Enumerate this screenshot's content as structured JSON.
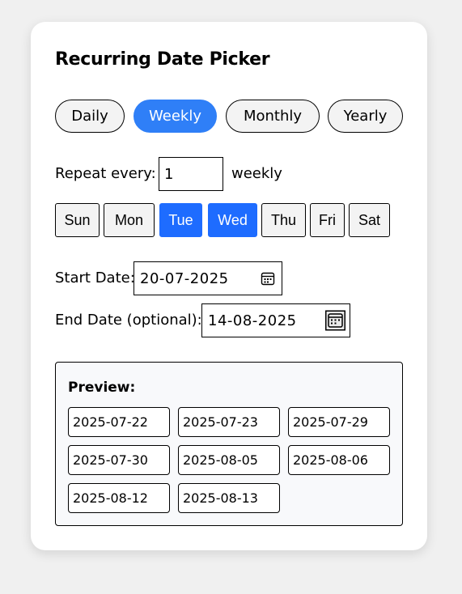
{
  "title": "Recurring Date Picker",
  "frequency_options": [
    {
      "label": "Daily",
      "active": false
    },
    {
      "label": "Weekly",
      "active": true
    },
    {
      "label": "Monthly",
      "active": false
    },
    {
      "label": "Yearly",
      "active": false
    }
  ],
  "repeat": {
    "label": "Repeat every:",
    "value": "1",
    "unit": "weekly"
  },
  "days": [
    {
      "label": "Sun",
      "active": false
    },
    {
      "label": "Mon",
      "active": false
    },
    {
      "label": "Tue",
      "active": true
    },
    {
      "label": "Wed",
      "active": true
    },
    {
      "label": "Thu",
      "active": false
    },
    {
      "label": "Fri",
      "active": false
    },
    {
      "label": "Sat",
      "active": false
    }
  ],
  "start_date": {
    "label": "Start Date:",
    "value": "20-07-2025",
    "icon": "calendar-icon"
  },
  "end_date": {
    "label": "End Date (optional):",
    "value": "14-08-2025",
    "icon": "calendar-icon"
  },
  "preview": {
    "title": "Preview:",
    "dates": [
      "2025-07-22",
      "2025-07-23",
      "2025-07-29",
      "2025-07-30",
      "2025-08-05",
      "2025-08-06",
      "2025-08-12",
      "2025-08-13"
    ]
  },
  "colors": {
    "accent": "#2f7ff7",
    "day_active": "#1e6cff",
    "background": "#f0f0f0",
    "card": "#ffffff"
  }
}
